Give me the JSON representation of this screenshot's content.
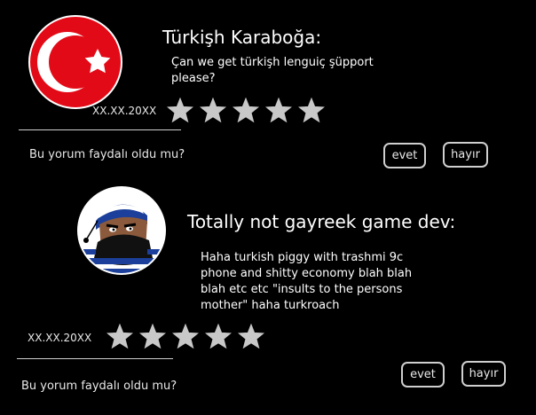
{
  "reviews": [
    {
      "reviewer_name": "Türkişh Karaboğa:",
      "comment": "Çan we get türkişh lenguiç şüpport please?",
      "date": "XX.XX.20XX",
      "rating": 5,
      "helpful_question": "Bu yorum faydalı oldu mu?",
      "yes_label": "evet",
      "no_label": "hayır",
      "avatar_icon": "turkish-flag-countryball-icon"
    },
    {
      "reviewer_name": "Totally not gayreek game dev:",
      "comment": "Haha turkish piggy with trashmi 9c phone and shitty economy blah blah blah etc etc \"insults to the persons mother\" haha turkroach",
      "date": "XX.XX.20XX",
      "rating": 5,
      "helpful_question": "Bu yorum faydalı oldu mu?",
      "yes_label": "evet",
      "no_label": "hayır",
      "avatar_icon": "greek-countryball-icon"
    }
  ],
  "colors": {
    "background": "#000000",
    "turkey_red": "#e30a17",
    "greek_blue": "#1b3f9a",
    "star_gray": "#c8c8c8",
    "border_gray": "#cfcfcf"
  }
}
